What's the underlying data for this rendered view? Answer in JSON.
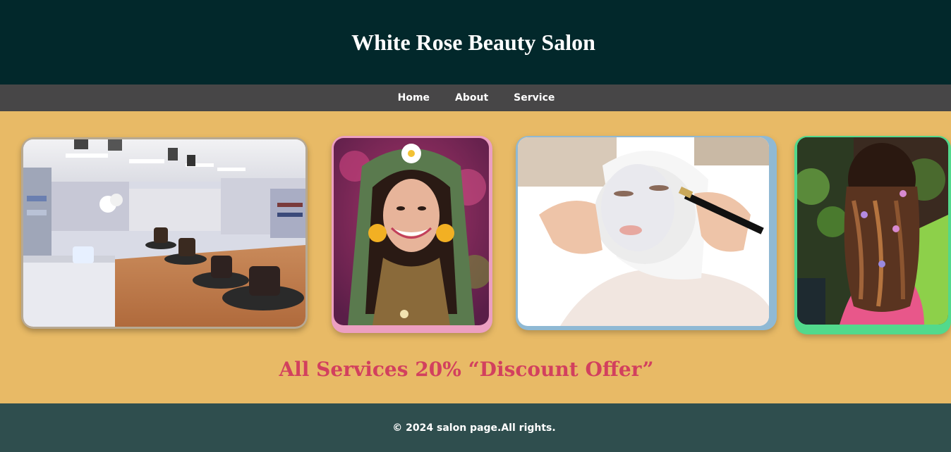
{
  "header": {
    "title": "White Rose Beauty Salon"
  },
  "nav": {
    "items": [
      {
        "label": "Home"
      },
      {
        "label": "About"
      },
      {
        "label": "Service"
      }
    ]
  },
  "gallery": {
    "photos": [
      {
        "subject": "salon-interior"
      },
      {
        "subject": "bride-portrait"
      },
      {
        "subject": "facial-treatment"
      },
      {
        "subject": "hairstyle"
      }
    ]
  },
  "offer": {
    "text": "All Services 20% “Discount Offer”"
  },
  "footer": {
    "copyright": "© 2024 salon page.All rights."
  },
  "colors": {
    "header_bg": "#02282b",
    "nav_bg": "#474647",
    "page_bg": "#e8ba66",
    "offer_text": "#d2405e",
    "footer_bg": "#2f4e4e",
    "frame_gray": "#b7a993",
    "frame_pink": "#ec9fc1",
    "frame_blue": "#8fb9d4",
    "frame_green": "#52d98c"
  }
}
